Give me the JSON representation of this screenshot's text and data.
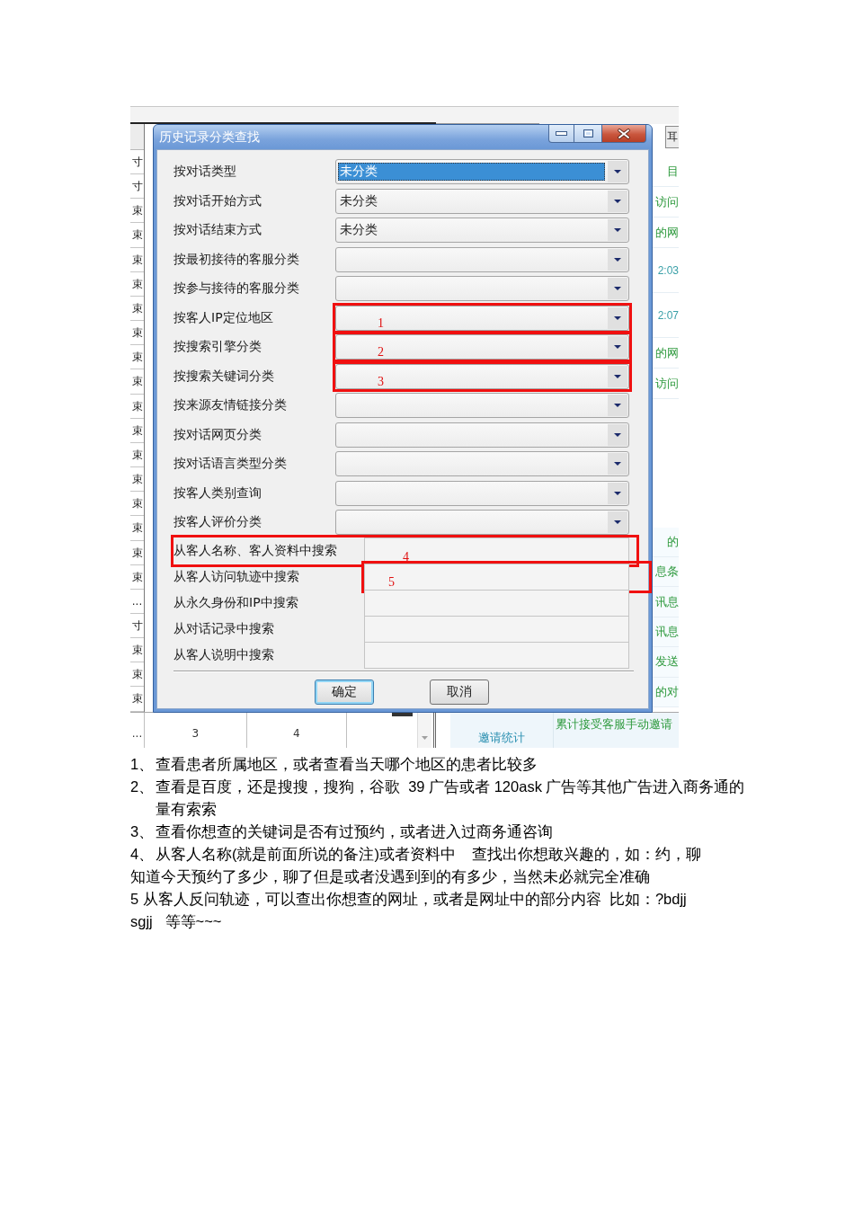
{
  "background_app": {
    "corner_button": "耳",
    "left_column": [
      "寸",
      "寸",
      "束",
      "束",
      "束",
      "束",
      "束",
      "束",
      "束",
      "束",
      "束",
      "束",
      "束",
      "束",
      "束",
      "束",
      "束",
      "束",
      "...",
      "寸",
      "束",
      "束",
      "束"
    ],
    "right_panel": {
      "upper": [
        {
          "kind": "text",
          "text": "目"
        },
        {
          "kind": "text",
          "text": "访问"
        },
        {
          "kind": "text",
          "text": "的网"
        },
        {
          "kind": "time",
          "text": "2:03"
        },
        {
          "kind": "time",
          "text": "2:07"
        },
        {
          "kind": "text",
          "text": "的网"
        },
        {
          "kind": "text",
          "text": "访问"
        }
      ],
      "lower": [
        {
          "kind": "text",
          "text": "的"
        },
        {
          "kind": "text",
          "text": "息条"
        },
        {
          "kind": "text",
          "text": "讯息"
        },
        {
          "kind": "text",
          "text": "讯息"
        },
        {
          "kind": "text",
          "text": "发送"
        },
        {
          "kind": "text",
          "text": "的对"
        }
      ]
    },
    "bottom_row": [
      "...",
      "3",
      "4"
    ],
    "footer": {
      "category": "邀请统计",
      "metric": "累计接受客服手动邀请"
    }
  },
  "dialog": {
    "title": "历史记录分类查找",
    "dropdowns": [
      {
        "label": "按对话类型",
        "value": "未分类",
        "focused": true
      },
      {
        "label": "按对话开始方式",
        "value": "未分类",
        "focused": false
      },
      {
        "label": "按对话结束方式",
        "value": "未分类",
        "focused": false
      },
      {
        "label": "按最初接待的客服分类",
        "focused": false
      },
      {
        "label": "按参与接待的客服分类",
        "focused": false
      },
      {
        "label": "按客人IP定位地区",
        "focused": false,
        "annotation": {
          "kind": "field",
          "number": "1"
        }
      },
      {
        "label": "按搜索引擎分类",
        "focused": false,
        "annotation": {
          "kind": "field",
          "number": "2"
        }
      },
      {
        "label": "按搜索关键词分类",
        "focused": false,
        "annotation": {
          "kind": "field",
          "number": "3"
        }
      },
      {
        "label": "按来源友情链接分类",
        "focused": false
      },
      {
        "label": "按对话网页分类",
        "focused": false
      },
      {
        "label": "按对话语言类型分类",
        "focused": false
      },
      {
        "label": "按客人类别查询",
        "focused": false
      },
      {
        "label": "按客人评价分类",
        "focused": false
      }
    ],
    "search_fields": [
      {
        "label": "从客人名称、客人资料中搜索",
        "annotation": {
          "kind": "row",
          "number": "4"
        }
      },
      {
        "label": "从客人访问轨迹中搜索",
        "annotation": {
          "kind": "field",
          "number": "5"
        }
      },
      {
        "label": "从永久身份和IP中搜索"
      },
      {
        "label": "从对话记录中搜索"
      },
      {
        "label": "从客人说明中搜索"
      }
    ],
    "buttons": [
      {
        "label": "确定",
        "focused": true
      },
      {
        "label": "取消",
        "focused": false
      }
    ]
  },
  "notes": [
    {
      "kind": "numbered",
      "marker": "1、",
      "lines": [
        "查看患者所属地区，或者查看当天哪个地区的患者比较多"
      ]
    },
    {
      "kind": "numbered",
      "marker": "2、",
      "lines": [
        "查看是百度，还是搜搜，搜狗，谷歌  39 广告或者 120ask 广告等其他广告进入商务通的",
        "量有索索"
      ]
    },
    {
      "kind": "numbered",
      "marker": "3、",
      "lines": [
        "查看你想查的关键词是否有过预约，或者进入过商务通咨询"
      ]
    },
    {
      "kind": "numbered",
      "marker": "4、",
      "lines": [
        "从客人名称(就是前面所说的备注)或者资料中    查找出你想敢兴趣的，如：约，聊"
      ]
    },
    {
      "kind": "plain",
      "lines": [
        "知道今天预约了多少，聊了但是或者没遇到到的有多少，当然未必就完全准确"
      ]
    },
    {
      "kind": "plain",
      "lines": [
        "5 从客人反问轨迹，可以查出你想查的网址，或者是网址中的部分内容  比如：?bdjj",
        "sgjj   等等~~~"
      ]
    }
  ]
}
